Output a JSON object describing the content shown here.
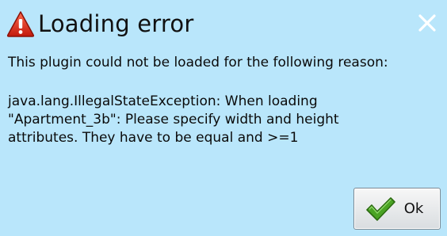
{
  "dialog": {
    "title": "Loading error",
    "intro": "This plugin could not be loaded for the following reason:",
    "error": "java.lang.IllegalStateException: When loading\n\"Apartment_3b\": Please specify width and height\nattributes. They have to be equal and >=1",
    "ok_label": "Ok"
  },
  "icons": {
    "title_icon": "warning-icon",
    "close_icon": "close-icon",
    "ok_icon": "check-icon"
  },
  "colors": {
    "background": "#b9e6fb",
    "warning_red": "#e02a1a",
    "check_green": "#3c9a1e"
  }
}
